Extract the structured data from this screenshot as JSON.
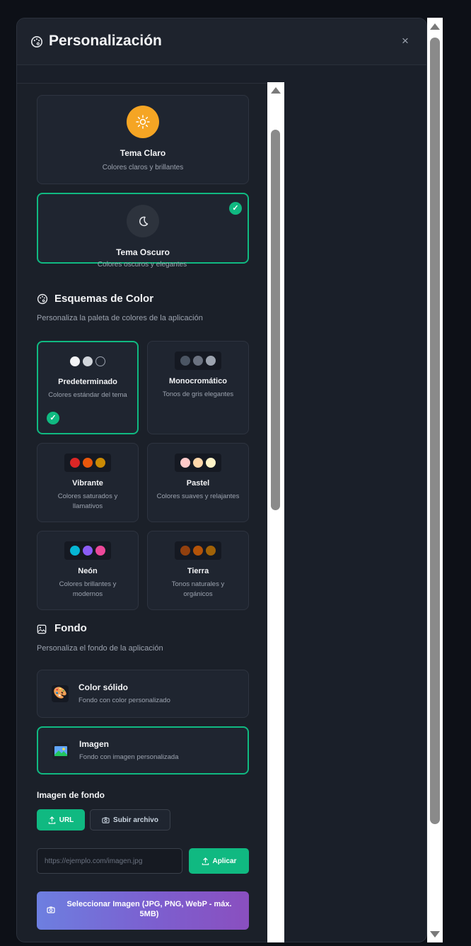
{
  "header": {
    "title": "Personalización",
    "close_label": "×"
  },
  "themes": [
    {
      "title": "Tema Claro",
      "subtitle": "Colores claros y brillantes",
      "selected": false,
      "icon": "sun-icon",
      "icon_bg": "#f5a524"
    },
    {
      "title": "Tema Oscuro",
      "subtitle": "Colores oscuros y elegantes",
      "selected": true,
      "icon": "moon-icon",
      "icon_bg": "#2d333d"
    }
  ],
  "color_schemes": {
    "title": "Esquemas de Color",
    "subtitle": "Personaliza la paleta de colores de la aplicación",
    "items": [
      {
        "name": "Predeterminado",
        "desc": "Colores estándar del tema",
        "selected": true,
        "colors": [
          "#f3f4f6",
          "#d1d5db",
          "#1f2530"
        ]
      },
      {
        "name": "Monocromático",
        "desc": "Tonos de gris elegantes",
        "selected": false,
        "colors": [
          "#4b5563",
          "#6b7280",
          "#9ca3af"
        ]
      },
      {
        "name": "Vibrante",
        "desc": "Colores saturados y llamativos",
        "selected": false,
        "colors": [
          "#dc2626",
          "#ea580c",
          "#ca8a04"
        ]
      },
      {
        "name": "Pastel",
        "desc": "Colores suaves y relajantes",
        "selected": false,
        "colors": [
          "#fecaca",
          "#fed7aa",
          "#fef3c7"
        ]
      },
      {
        "name": "Neón",
        "desc": "Colores brillantes y modernos",
        "selected": false,
        "colors": [
          "#06b6d4",
          "#8b5cf6",
          "#ec4899"
        ]
      },
      {
        "name": "Tierra",
        "desc": "Tonos naturales y orgánicos",
        "selected": false,
        "colors": [
          "#92400e",
          "#b45309",
          "#a16207"
        ]
      }
    ]
  },
  "background": {
    "title": "Fondo",
    "subtitle": "Personaliza el fondo de la aplicación",
    "options": [
      {
        "title": "Color sólido",
        "subtitle": "Fondo con color personalizado",
        "icon": "palette-icon",
        "selected": false
      },
      {
        "title": "Imagen",
        "subtitle": "Fondo con imagen personalizada",
        "icon": "image-icon",
        "selected": true
      }
    ],
    "image_label": "Imagen de fondo",
    "tab_url": "URL",
    "tab_upload": "Subir archivo",
    "url_placeholder": "https://ejemplo.com/imagen.jpg",
    "apply_label": "Aplicar",
    "select_image_label": "Seleccionar Imagen (JPG, PNG, WebP - máx. 5MB)"
  },
  "colors": {
    "accent": "#10b981",
    "card_bg": "#1f2530",
    "panel_bg": "#1b2029"
  }
}
